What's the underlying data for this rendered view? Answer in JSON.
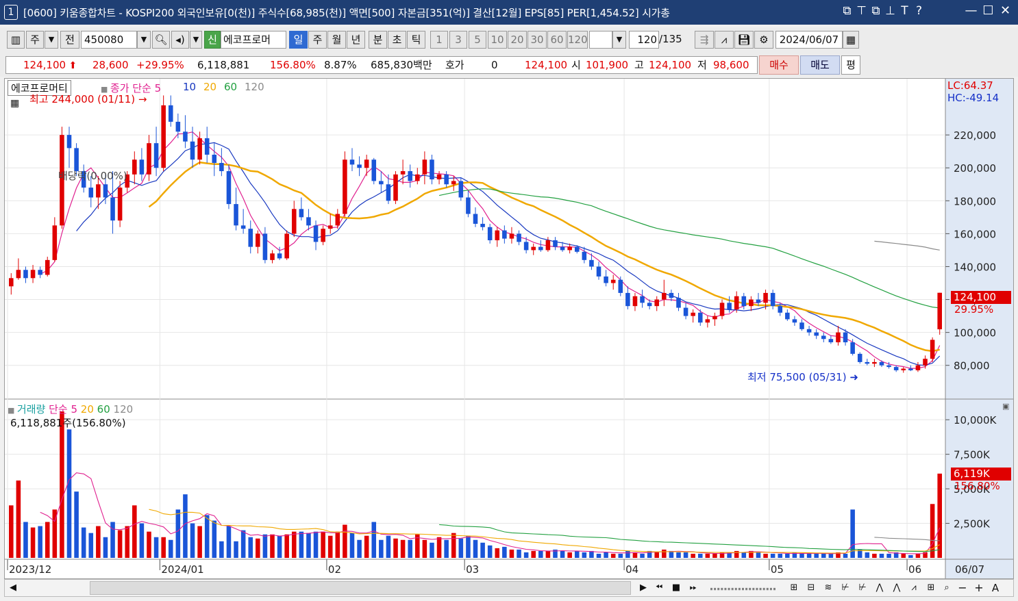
{
  "titlebar": {
    "win_num": "1",
    "text": "[0600] 키움종합차트 - KOSPI200 외국인보유[0(천)] 주식수[68,985(천)] 액면[500] 자본금[351(억)] 결산[12월] EPS[85] PER[1,454.52] 시가총",
    "icons": [
      "window-icon",
      "pin-icon",
      "restore-icon",
      "push-pin-icon",
      "T",
      "?"
    ],
    "controls": [
      "—",
      "☐",
      "✕"
    ]
  },
  "toolbar": {
    "period_label": "주",
    "all_label": "전",
    "code": "450080",
    "new_badge": "신",
    "stock_name": "에코프로머",
    "periods": [
      "일",
      "주",
      "월",
      "년",
      "분",
      "초",
      "틱"
    ],
    "intervals": [
      "1",
      "3",
      "5",
      "10",
      "20",
      "30",
      "60",
      "120"
    ],
    "count": "120",
    "count_total": "/135",
    "date": "2024/06/07"
  },
  "quote": {
    "price": "124,100",
    "change": "28,600",
    "change_pct": "+29.95%",
    "volume": "6,118,881",
    "volume_pct": "156.80%",
    "turnover": "8.87%",
    "trade_amount": "685,830백만",
    "hoga_label": "호가",
    "hoga_value": "0",
    "ask_price": "124,100",
    "open_label": "시",
    "open": "101,900",
    "high_label": "고",
    "high": "124,100",
    "low_label": "저",
    "low": "98,600",
    "buy_label": "매수",
    "sell_label": "매도",
    "avg_label": "평"
  },
  "chart_labels": {
    "stock_name": "에코프로머티",
    "ma_title": "종가 단순",
    "ma_periods": [
      "5",
      "10",
      "20",
      "60",
      "120"
    ],
    "ma_colors": [
      "#e0208f",
      "#1838c0",
      "#f0a800",
      "#22a040",
      "#8a8a8a"
    ],
    "max_annot": "최고 244,000 (01/11)",
    "min_annot": "최저 75,500 (05/31)",
    "dividend": "배당락(0.00%)",
    "lc": "LC:64.37",
    "hc": "HC:-49.14",
    "price_axis": [
      "220,000",
      "200,000",
      "180,000",
      "160,000",
      "140,000",
      "120,000",
      "100,000",
      "80,000"
    ],
    "last_price": "124,100",
    "last_pct": "29.95%",
    "vol_title": "거래량",
    "vol_ma_title": "단순",
    "vol_ma_periods": [
      "5",
      "20",
      "60",
      "120"
    ],
    "vol_current": "6,118,881주(156.80%)",
    "vol_axis": [
      "10,000K",
      "7,500K",
      "5,000K",
      "2,500K"
    ],
    "vol_last": "6,119K",
    "vol_last_pct": "156.80%",
    "date_axis": [
      "2023/12",
      "2024/01",
      "02",
      "03",
      "04",
      "05",
      "06",
      "06/07"
    ]
  },
  "chart_data": {
    "type": "candlestick",
    "price_range": [
      62000,
      250000
    ],
    "volume_range": [
      0,
      11000000
    ],
    "candles": [
      [
        128000,
        136000,
        123000,
        133000
      ],
      [
        133000,
        145000,
        132000,
        138000
      ],
      [
        138000,
        140000,
        130000,
        133000
      ],
      [
        133000,
        141000,
        130000,
        138000
      ],
      [
        138000,
        140000,
        133000,
        135000
      ],
      [
        135000,
        146000,
        134000,
        144000
      ],
      [
        144000,
        170000,
        143000,
        165000
      ],
      [
        165000,
        225000,
        163000,
        220000
      ],
      [
        220000,
        225000,
        200000,
        212000
      ],
      [
        212000,
        215000,
        195000,
        198000
      ],
      [
        198000,
        202000,
        185000,
        188000
      ],
      [
        188000,
        195000,
        176000,
        182000
      ],
      [
        182000,
        195000,
        175000,
        190000
      ],
      [
        190000,
        196000,
        178000,
        182000
      ],
      [
        182000,
        198000,
        160000,
        168000
      ],
      [
        168000,
        192000,
        164000,
        188000
      ],
      [
        188000,
        198000,
        185000,
        196000
      ],
      [
        196000,
        210000,
        190000,
        205000
      ],
      [
        205000,
        212000,
        192000,
        196000
      ],
      [
        196000,
        220000,
        192000,
        215000
      ],
      [
        215000,
        225000,
        195000,
        200000
      ],
      [
        200000,
        244000,
        198000,
        238000
      ],
      [
        238000,
        244000,
        225000,
        228000
      ],
      [
        228000,
        233000,
        218000,
        222000
      ],
      [
        222000,
        232000,
        212000,
        216000
      ],
      [
        216000,
        225000,
        200000,
        205000
      ],
      [
        205000,
        222000,
        202000,
        218000
      ],
      [
        218000,
        225000,
        203000,
        208000
      ],
      [
        208000,
        215000,
        195000,
        203000
      ],
      [
        203000,
        212000,
        195000,
        198000
      ],
      [
        198000,
        202000,
        175000,
        178000
      ],
      [
        178000,
        188000,
        162000,
        165000
      ],
      [
        165000,
        175000,
        160000,
        163000
      ],
      [
        163000,
        168000,
        148000,
        152000
      ],
      [
        152000,
        162000,
        148000,
        160000
      ],
      [
        160000,
        164000,
        142000,
        144000
      ],
      [
        144000,
        150000,
        142000,
        148000
      ],
      [
        148000,
        152000,
        144000,
        145000
      ],
      [
        145000,
        162000,
        144000,
        160000
      ],
      [
        160000,
        180000,
        158000,
        175000
      ],
      [
        175000,
        182000,
        168000,
        170000
      ],
      [
        170000,
        175000,
        162000,
        165000
      ],
      [
        165000,
        168000,
        150000,
        155000
      ],
      [
        155000,
        165000,
        153000,
        163000
      ],
      [
        163000,
        172000,
        160000,
        165000
      ],
      [
        165000,
        175000,
        163000,
        172000
      ],
      [
        172000,
        210000,
        170000,
        205000
      ],
      [
        205000,
        212000,
        198000,
        202000
      ],
      [
        202000,
        207000,
        195000,
        200000
      ],
      [
        200000,
        208000,
        195000,
        205000
      ],
      [
        205000,
        206000,
        190000,
        192000
      ],
      [
        192000,
        198000,
        185000,
        190000
      ],
      [
        190000,
        196000,
        178000,
        180000
      ],
      [
        180000,
        198000,
        178000,
        196000
      ],
      [
        196000,
        205000,
        190000,
        198000
      ],
      [
        198000,
        202000,
        188000,
        192000
      ],
      [
        192000,
        200000,
        190000,
        196000
      ],
      [
        196000,
        210000,
        190000,
        205000
      ],
      [
        205000,
        208000,
        190000,
        193000
      ],
      [
        193000,
        198000,
        190000,
        196000
      ],
      [
        196000,
        198000,
        188000,
        190000
      ],
      [
        190000,
        195000,
        186000,
        192000
      ],
      [
        192000,
        194000,
        180000,
        182000
      ],
      [
        182000,
        186000,
        170000,
        172000
      ],
      [
        172000,
        176000,
        164000,
        166000
      ],
      [
        166000,
        170000,
        162000,
        164000
      ],
      [
        164000,
        166000,
        154000,
        156000
      ],
      [
        156000,
        164000,
        152000,
        162000
      ],
      [
        162000,
        165000,
        154000,
        157000
      ],
      [
        157000,
        164000,
        154000,
        160000
      ],
      [
        160000,
        162000,
        153000,
        155000
      ],
      [
        155000,
        158000,
        148000,
        150000
      ],
      [
        150000,
        154000,
        147000,
        152000
      ],
      [
        152000,
        156000,
        149000,
        150000
      ],
      [
        150000,
        158000,
        149000,
        156000
      ],
      [
        156000,
        158000,
        150000,
        152000
      ],
      [
        152000,
        155000,
        149000,
        150000
      ],
      [
        150000,
        154000,
        148000,
        152000
      ],
      [
        152000,
        153000,
        148000,
        149000
      ],
      [
        149000,
        152000,
        142000,
        144000
      ],
      [
        144000,
        148000,
        138000,
        140000
      ],
      [
        140000,
        143000,
        132000,
        134000
      ],
      [
        134000,
        138000,
        128000,
        130000
      ],
      [
        130000,
        135000,
        126000,
        132000
      ],
      [
        132000,
        134000,
        122000,
        124000
      ],
      [
        124000,
        128000,
        114000,
        116000
      ],
      [
        116000,
        124000,
        113000,
        122000
      ],
      [
        122000,
        126000,
        115000,
        118000
      ],
      [
        118000,
        120000,
        114000,
        116000
      ],
      [
        116000,
        122000,
        113000,
        120000
      ],
      [
        120000,
        132000,
        116000,
        124000
      ],
      [
        124000,
        126000,
        119000,
        121000
      ],
      [
        121000,
        124000,
        113000,
        115000
      ],
      [
        115000,
        118000,
        108000,
        110000
      ],
      [
        110000,
        114000,
        106000,
        112000
      ],
      [
        112000,
        114000,
        104000,
        106000
      ],
      [
        106000,
        110000,
        103000,
        108000
      ],
      [
        108000,
        112000,
        104000,
        110000
      ],
      [
        110000,
        120000,
        108000,
        118000
      ],
      [
        118000,
        122000,
        112000,
        114000
      ],
      [
        114000,
        125000,
        112000,
        122000
      ],
      [
        122000,
        124000,
        114000,
        116000
      ],
      [
        116000,
        122000,
        113000,
        120000
      ],
      [
        120000,
        124000,
        116000,
        118000
      ],
      [
        118000,
        126000,
        114000,
        124000
      ],
      [
        124000,
        126000,
        114000,
        116000
      ],
      [
        116000,
        118000,
        110000,
        112000
      ],
      [
        112000,
        114000,
        107000,
        108000
      ],
      [
        108000,
        110000,
        104000,
        106000
      ],
      [
        106000,
        108000,
        101000,
        102000
      ],
      [
        102000,
        104000,
        98000,
        100000
      ],
      [
        100000,
        102000,
        96000,
        98000
      ],
      [
        98000,
        100000,
        94000,
        96000
      ],
      [
        96000,
        98000,
        93000,
        94000
      ],
      [
        94000,
        104000,
        92000,
        100000
      ],
      [
        100000,
        102000,
        92000,
        94000
      ],
      [
        94000,
        96000,
        86000,
        87000
      ],
      [
        87000,
        88000,
        81000,
        82000
      ],
      [
        82000,
        84000,
        80000,
        81000
      ],
      [
        81000,
        84000,
        79000,
        82000
      ],
      [
        82000,
        83000,
        79000,
        80000
      ],
      [
        80000,
        82000,
        78000,
        79000
      ],
      [
        79000,
        80000,
        76000,
        77000
      ],
      [
        77000,
        79000,
        75500,
        78000
      ],
      [
        78000,
        80000,
        76500,
        77000
      ],
      [
        77000,
        82000,
        76000,
        80000
      ],
      [
        80000,
        86000,
        78000,
        84000
      ],
      [
        84000,
        97000,
        82000,
        95500
      ],
      [
        101900,
        124100,
        98600,
        124100
      ]
    ],
    "volumes": [
      3.8,
      5.6,
      2.6,
      2.2,
      2.3,
      2.6,
      3.5,
      10.6,
      9.3,
      4.8,
      2.2,
      1.8,
      2.3,
      1.5,
      2.6,
      2.0,
      2.3,
      3.8,
      2.5,
      1.9,
      1.5,
      1.5,
      1.3,
      3.5,
      4.6,
      2.5,
      2.3,
      3.1,
      2.7,
      1.2,
      2.3,
      1.2,
      2.0,
      1.5,
      1.4,
      1.7,
      1.7,
      1.6,
      1.7,
      1.9,
      1.9,
      1.8,
      1.9,
      1.9,
      1.6,
      1.9,
      2.4,
      1.8,
      1.3,
      1.6,
      2.6,
      1.3,
      1.6,
      1.4,
      1.3,
      1.3,
      1.7,
      1.3,
      1.1,
      1.5,
      1.3,
      1.8,
      1.4,
      1.6,
      1.3,
      1.1,
      0.9,
      0.7,
      0.8,
      0.6,
      0.6,
      0.4,
      0.5,
      0.5,
      0.5,
      0.6,
      0.5,
      0.4,
      0.5,
      0.4,
      0.5,
      0.3,
      0.4,
      0.3,
      0.3,
      0.5,
      0.4,
      0.3,
      0.5,
      0.4,
      0.6,
      0.5,
      0.4,
      0.4,
      0.3,
      0.3,
      0.3,
      0.3,
      0.4,
      0.4,
      0.5,
      0.4,
      0.5,
      0.4,
      0.3,
      0.3,
      0.3,
      0.3,
      0.4,
      0.3,
      0.3,
      0.3,
      0.3,
      0.3,
      0.4,
      0.3,
      3.5,
      0.6,
      0.4,
      0.3,
      0.3,
      0.3,
      0.4,
      0.3,
      0.2,
      0.3,
      0.4,
      3.9,
      6.1
    ]
  }
}
